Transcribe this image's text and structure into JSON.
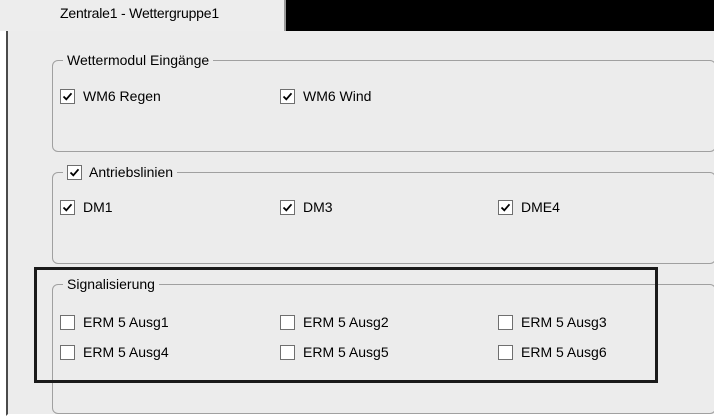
{
  "tab": {
    "label": "Zentrale1 - Wettergruppe1"
  },
  "groups": {
    "wettermodul": {
      "title": "Wettermodul Eingänge",
      "items": [
        {
          "label": "WM6 Regen",
          "checked": true
        },
        {
          "label": "WM6 Wind",
          "checked": true
        }
      ]
    },
    "antriebslinien": {
      "title": "Antriebslinien",
      "title_checked": true,
      "items": [
        {
          "label": "DM1",
          "checked": true
        },
        {
          "label": "DM3",
          "checked": true
        },
        {
          "label": "DME4",
          "checked": true
        }
      ]
    },
    "signalisierung": {
      "title": "Signalisierung",
      "items": [
        {
          "label": "ERM 5 Ausg1",
          "checked": false
        },
        {
          "label": "ERM 5 Ausg2",
          "checked": false
        },
        {
          "label": "ERM 5 Ausg3",
          "checked": false
        },
        {
          "label": "ERM 5 Ausg4",
          "checked": false
        },
        {
          "label": "ERM 5 Ausg5",
          "checked": false
        },
        {
          "label": "ERM 5 Ausg6",
          "checked": false
        }
      ]
    }
  },
  "colors": {
    "panel": "#ececec",
    "titlebar": "#000000",
    "border": "#a0a0a0"
  }
}
